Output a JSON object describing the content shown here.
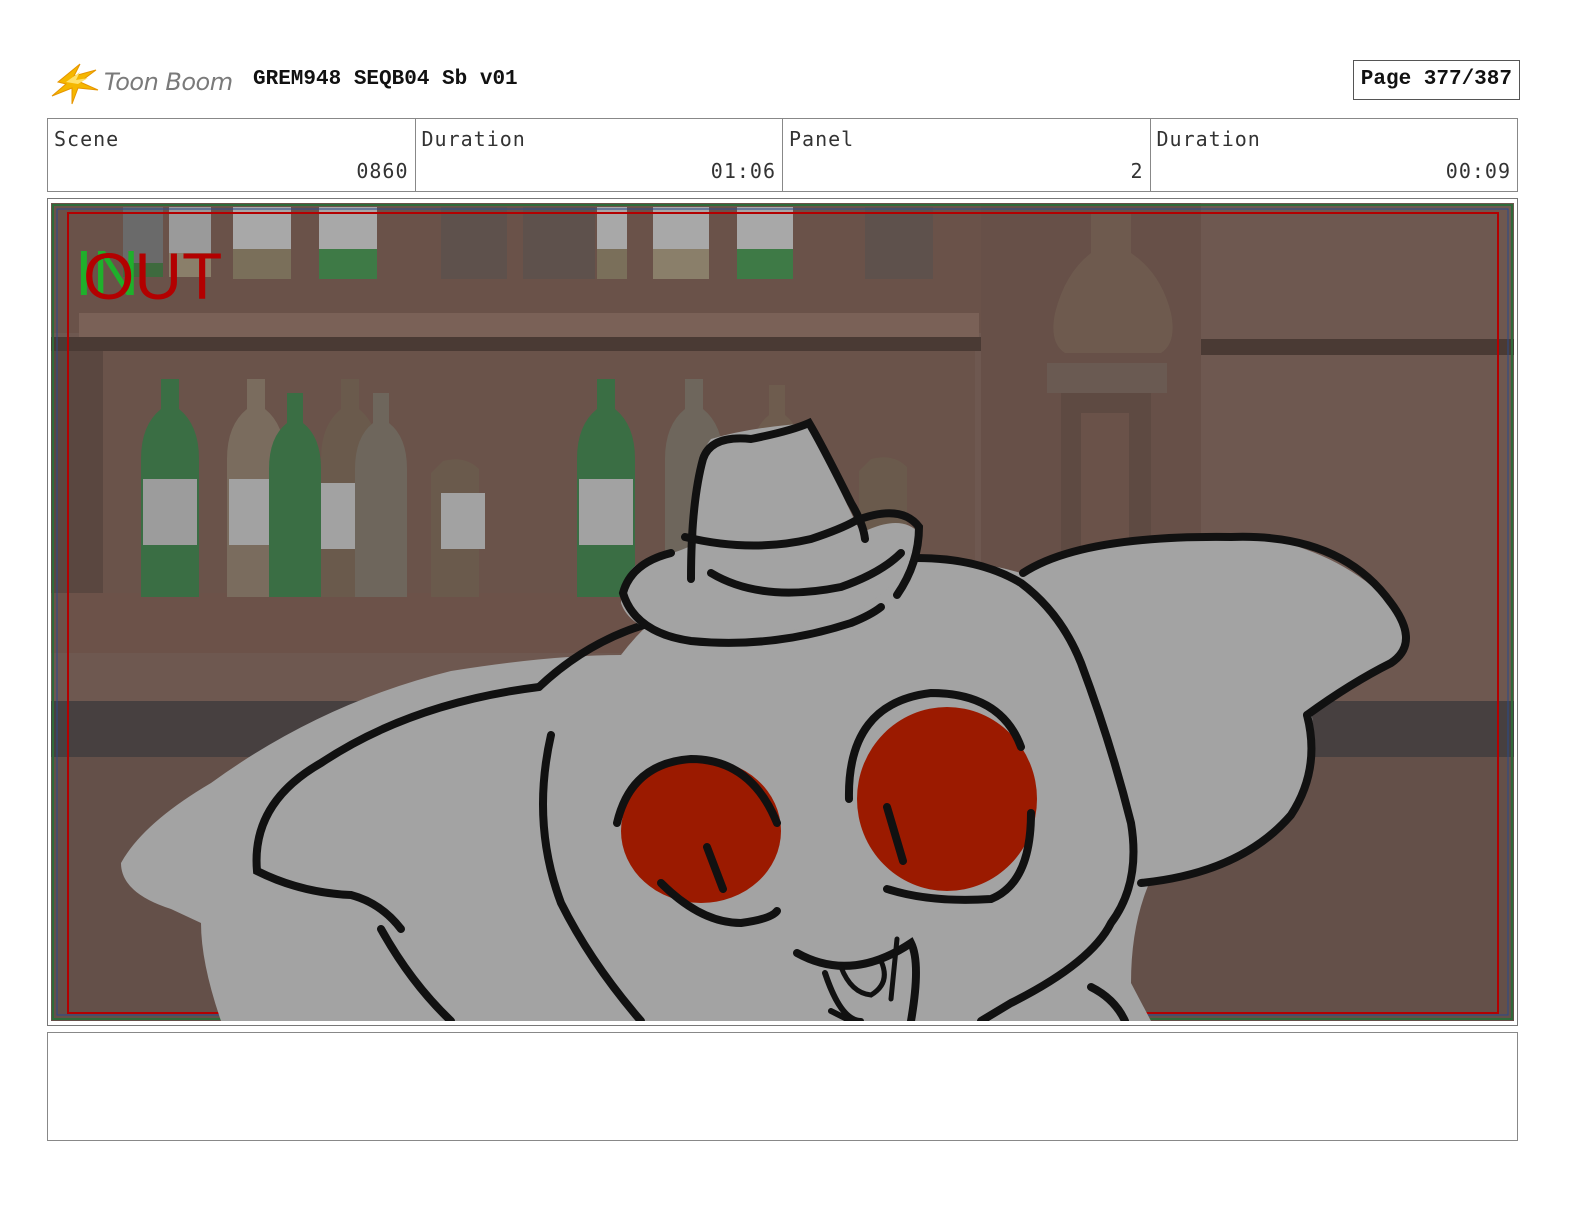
{
  "header": {
    "logo_text": "Toon Boom",
    "project_title": "GREM948 SEQB04 Sb v01",
    "page_label": "Page 377/387"
  },
  "info": {
    "scene_label": "Scene",
    "scene_value": "0860",
    "scene_duration_label": "Duration",
    "scene_duration_value": "01:06",
    "panel_label": "Panel",
    "panel_value": "2",
    "panel_duration_label": "Duration",
    "panel_duration_value": "00:09"
  },
  "panel": {
    "in_marker": "IN",
    "out_marker": "OUT",
    "colors": {
      "in_marker": "#1fb02b",
      "out_marker": "#b30000",
      "eye_fill": "#9b1a00",
      "body_fill": "#a3a3a3",
      "wall": "#6e5850"
    }
  },
  "notes": {
    "text": ""
  }
}
